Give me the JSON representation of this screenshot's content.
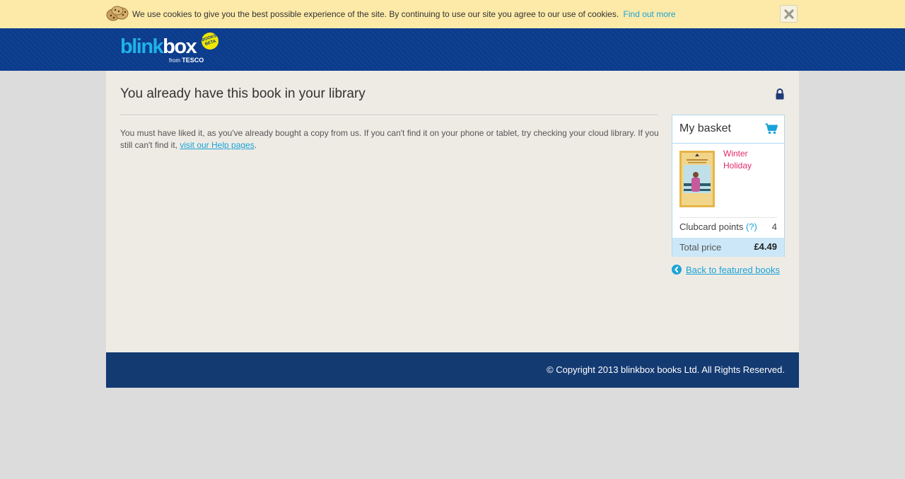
{
  "cookie_bar": {
    "message": "We use cookies to give you the best possible experience of the site. By continuing to use our site you agree to our use of cookies.",
    "link_label": "Find out more",
    "close_icon": "close-icon"
  },
  "header": {
    "logo": {
      "blink": "blink",
      "box": "box",
      "from": "from",
      "tesco": "TESCO",
      "badge_top": "BOOKS",
      "badge_bottom": "BETA"
    }
  },
  "main": {
    "title": "You already have this book in your library",
    "lock_icon": "lock-icon",
    "message_text": "You must have liked it, as you've already bought a copy from us. If you can't find it on your phone or tablet, try checking your cloud library. If you still can't find it, ",
    "message_link": "visit our Help pages",
    "message_end": "."
  },
  "basket": {
    "title": "My basket",
    "cart_icon": "cart-icon",
    "item": {
      "name": "Winter Holiday",
      "cover_title": "Winter Holiday"
    },
    "points_label": "Clubcard points",
    "points_help": "(?)",
    "points_value": "4",
    "total_label": "Total price",
    "total_value": "£4.49"
  },
  "back_link": {
    "label": "Back to featured books"
  },
  "footer": {
    "copyright": "© Copyright 2013 blinkbox books Ltd. All Rights Reserved."
  },
  "colors": {
    "cookie_bg": "#fdeaa8",
    "header_bg": "#0a3b8c",
    "footer_bg": "#143a72",
    "link": "#1aa3d9",
    "book_title": "#e0286a",
    "total_bg": "#cce8f8"
  }
}
